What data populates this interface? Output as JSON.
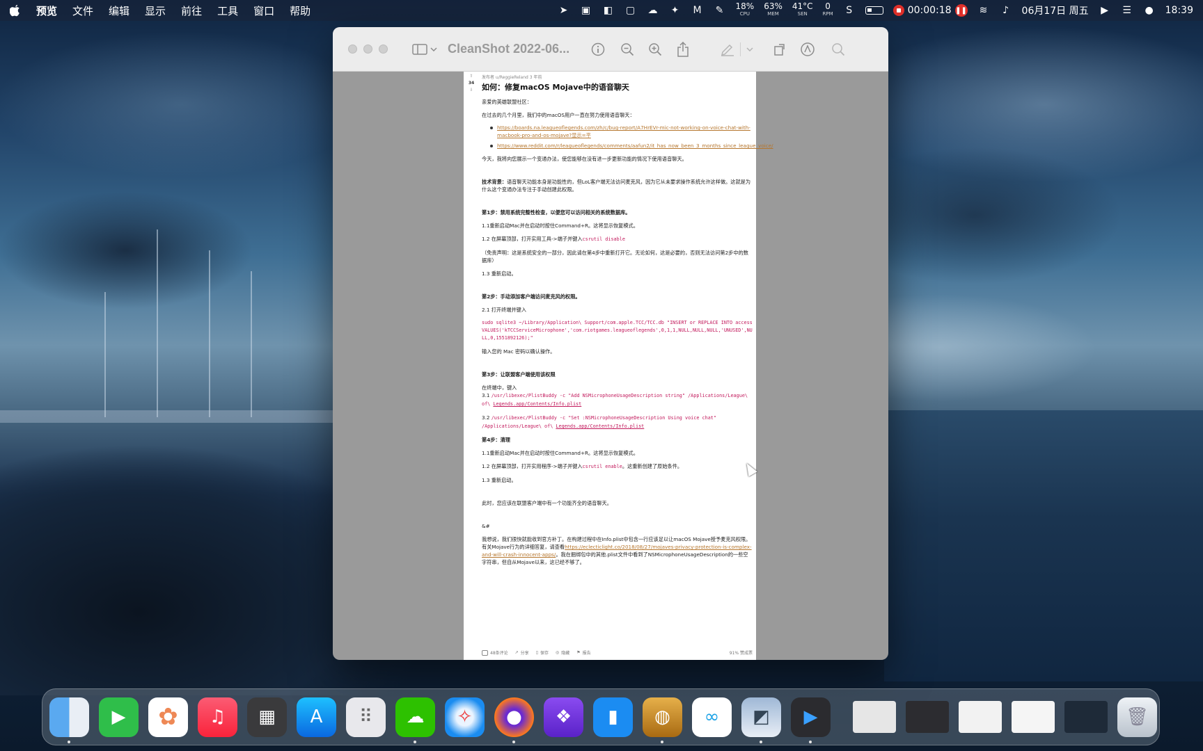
{
  "menubar": {
    "app_name": "预览",
    "items": [
      "文件",
      "编辑",
      "显示",
      "前往",
      "工具",
      "窗口",
      "帮助"
    ],
    "cpu": {
      "value": "18%",
      "label": "CPU"
    },
    "mem": {
      "value": "63%",
      "label": "MEM"
    },
    "sen": {
      "value": "41°C",
      "label": "SEN"
    },
    "rpm": {
      "value": "0",
      "label": "RPM"
    },
    "record_time": "00:00:18",
    "date": "06月17日 周五",
    "time": "18:39"
  },
  "window": {
    "title": "CleanShot 2022-06..."
  },
  "post": {
    "meta": "发布者 u/ReggieReland 3 年前",
    "score": "34",
    "title": "如何：修复macOS Mojave中的语音聊天",
    "greeting": "亲爱的英雄联盟社区：",
    "intro": "在过去的几个月里，我们中的macOS用户一直在努力使用语音聊天：",
    "links": [
      "https://boards.na.leagueoflegends.com/zh/c/bug-report/A7HrEVr-mic-not-working-on-voice-chat-with-macbook-pro-and-os-mojave?显示=平",
      "https://www.reddit.com/r/leagueoflegends/comments/aafun2/it_has_now_been_3_months_since_league_voice/"
    ],
    "today": "今天，我将向您展示一个变通办法，使您能够在没有进一步更新功能的情况下使用语音聊天。",
    "background_label": "技术背景：",
    "background_text": "语音聊天功能本身是功能性的，但LoL客户端无法访问麦克风，因为它从未要求操作系统允许这样做。这就是为什么这个变通办法专注于手动创建此权限。",
    "step1_title": "第1步：禁用系统完整性检查，以便您可以访问相关的系统数据库。",
    "step1_1": "1.1重新启动Mac并在启动时按住Command+R。这将显示恢复模式。",
    "step1_2_prefix": "1.2 在屏幕顶部，打开实用工具->端子并键入",
    "step1_2_code": "csrutil disable",
    "disclaimer": "（免责声明：这是系统安全的一部分，因此请在第4步中重新打开它。无论如何，这是必要的，否则无法访问第2步中的数据库）",
    "step1_3": "1.3 重新启动。",
    "step2_title": "第2步：手动添加客户端访问麦克风的权限。",
    "step2_1": "2.1 打开终端并键入",
    "step2_code": "sudo sqlite3 ~/Library/Application\\ Support/com.apple.TCC/TCC.db \"INSERT or REPLACE INTO access VALUES('kTCCServiceMicrophone','com.riotgames.leagueoflegends',0,1,1,NULL,NULL,NULL,'UNUSED',NULL,0,1551892126);\"",
    "password": "输入您的 Mac 密码以确认操作。",
    "step3_title": "第3步：让联盟客户端使用该权限",
    "step3_intro": "在终端中，键入",
    "step3_1_prefix": "3.1 ",
    "step3_1_code": "/usr/libexec/PlistBuddy -c \"Add NSMicrophoneUsageDescription string\" /Applications/League\\ of\\ ",
    "step3_1_link": "Legends.app/Contents/Info.plist",
    "step3_2_prefix": "3.2 ",
    "step3_2_code": "/usr/libexec/PlistBuddy -c \"Set :NSMicrophoneUsageDescription Using voice chat\" /Applications/League\\ of\\ ",
    "step3_2_link": "Legends.app/Contents/Info.plist",
    "step4_title": "第4步：清理",
    "step4_1": "1.1重新启动Mac并在启动时按住Command+R。这将显示恢复模式。",
    "step4_2_prefix": "1.2 在屏幕顶部，打开实用程序->端子并键入",
    "step4_2_code": "csrutil enable",
    "step4_2_suffix": "。这重新创建了原始条件。",
    "step4_3": "1.3 重新启动。",
    "done": "此时，您应该在联盟客户端中有一个功能齐全的语音聊天。",
    "amp": "&#",
    "closing_prefix": "我想说，我们很快就能收到官方补丁。在构建过程中在Info.plist中包含一行应该足以让macOS Mojave授予麦克风权限。有关Mojave行为的详细答复，请查看",
    "closing_link": "https://eclecticlight.co/2018/08/27/mojaves-privacy-protection-is-complex-and-will-crash-innocent-apps/",
    "closing_suffix": "。我在捆绑包中的其他.plist文件中看到了NSMicrophoneUsageDescription的一些空字符串，但自从Mojave以来，这已经不够了。",
    "actions": {
      "comments": "48条评论",
      "share": "分享",
      "save": "保存",
      "hide": "隐藏",
      "report": "报告",
      "upvote_ratio": "91% 赞成票"
    }
  },
  "dock": {
    "apps": [
      "finder-icon",
      "facetime-icon",
      "photos-icon",
      "music-icon",
      "calculator-icon",
      "app-store-icon",
      "launchpad-icon",
      "wechat-icon",
      "safari-icon",
      "firefox-icon",
      "app-icon",
      "bookmarks-icon",
      "automator-icon",
      "app-icon",
      "preview-icon",
      "video-player-icon"
    ]
  }
}
